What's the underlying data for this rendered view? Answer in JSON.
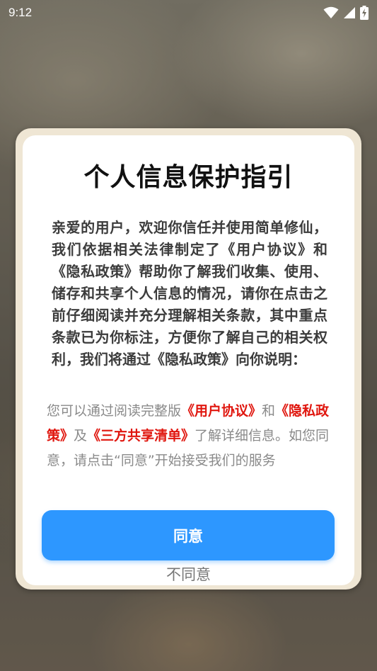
{
  "status_bar": {
    "time": "9:12",
    "icons": [
      "wifi-icon",
      "signal-icon",
      "battery-charging-icon"
    ]
  },
  "dialog": {
    "title": "个人信息保护指引",
    "body": "亲爱的用户，欢迎你信任并使用简单修仙，我们依据相关法律制定了《用户协议》和《隐私政策》帮助你了解我们收集、使用、储存和共享个人信息的情况，请你在点击之前仔细阅读并充分理解相关条款，其中重点条款已为你标注，方便你了解自己的相关权利，我们将通过《隐私政策》向你说明：",
    "hint": {
      "prefix": "您可以通过阅读完整版",
      "link_user_agreement": "《用户协议》",
      "and": "和",
      "link_privacy": "《隐私政策》",
      "and2": "及",
      "link_third_party": "《三方共享清单》",
      "suffix": "了解详细信息。如您同意，请点击“同意”开始接受我们的服务"
    },
    "agree_label": "同意",
    "disagree_label": "不同意"
  },
  "colors": {
    "accent_button": "#2d97ff",
    "link": "#e0160e",
    "dialog_frame": "#efe6d4"
  }
}
